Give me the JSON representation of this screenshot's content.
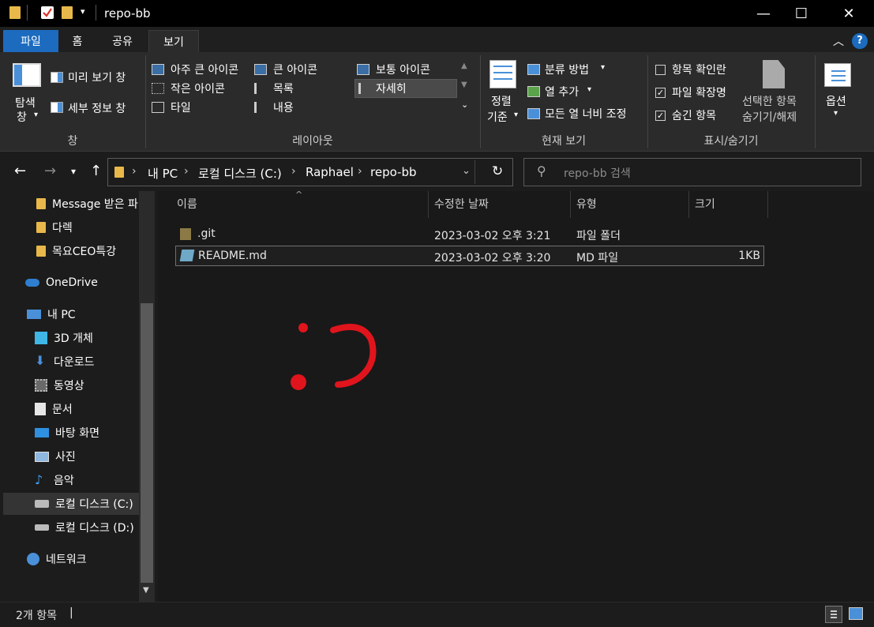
{
  "window": {
    "title": "repo-bb",
    "buttons": {
      "minimize": "—",
      "maximize": "☐",
      "close": "✕"
    }
  },
  "ribbon_tabs": [
    {
      "label": "파일"
    },
    {
      "label": "홈"
    },
    {
      "label": "공유"
    },
    {
      "label": "보기"
    }
  ],
  "ribbon": {
    "pane": {
      "nav_pane_label_1": "탐색",
      "nav_pane_label_2": "창",
      "preview_pane": "미리 보기 창",
      "details_pane": "세부 정보 창",
      "group_label": "창"
    },
    "layout": {
      "items": [
        "아주 큰 아이콘",
        "큰 아이콘",
        "보통 아이콘",
        "작은 아이콘",
        "목록",
        "자세히",
        "타일",
        "내용"
      ],
      "selected": "자세히",
      "group_label": "레이아웃"
    },
    "current_view": {
      "sort_by_1": "정렬",
      "sort_by_2": "기준",
      "group_by": "분류 방법",
      "add_columns": "열 추가",
      "size_all_columns": "모든 열 너비 조정",
      "group_label": "현재 보기"
    },
    "show_hide": {
      "item_checkboxes": "항목 확인란",
      "file_extensions": "파일 확장명",
      "hidden_items": "숨긴 항목",
      "hide_selected_1": "선택한 항목",
      "hide_selected_2": "숨기기/해제",
      "group_label": "표시/숨기기",
      "checked": [
        false,
        true,
        true
      ]
    },
    "options": {
      "label": "옵션"
    }
  },
  "address": {
    "crumbs": [
      "내 PC",
      "로컬 디스크 (C:)",
      "Raphael",
      "repo-bb"
    ],
    "search_placeholder": "repo-bb 검색"
  },
  "nav_pane": {
    "items": [
      {
        "label": "Message 받은 파",
        "icon": "folder-icon"
      },
      {
        "label": "다렉",
        "icon": "folder-icon"
      },
      {
        "label": "목요CEO특강",
        "icon": "folder-icon"
      },
      {
        "label": "OneDrive",
        "icon": "cloud-icon"
      },
      {
        "label": "내 PC",
        "icon": "pc-icon"
      },
      {
        "label": "3D 개체",
        "icon": "cube-icon"
      },
      {
        "label": "다운로드",
        "icon": "download-icon"
      },
      {
        "label": "동영상",
        "icon": "video-icon"
      },
      {
        "label": "문서",
        "icon": "document-icon"
      },
      {
        "label": "바탕 화면",
        "icon": "desktop-icon"
      },
      {
        "label": "사진",
        "icon": "pictures-icon"
      },
      {
        "label": "음악",
        "icon": "music-icon"
      },
      {
        "label": "로컬 디스크 (C:)",
        "icon": "drive-icon"
      },
      {
        "label": "로컬 디스크 (D:)",
        "icon": "drive-icon"
      },
      {
        "label": "네트워크",
        "icon": "network-icon"
      }
    ],
    "selected": "로컬 디스크 (C:)"
  },
  "file_list": {
    "columns": [
      "이름",
      "수정한 날짜",
      "유형",
      "크기"
    ],
    "rows": [
      {
        "name": ".git",
        "modified": "2023-03-02 오후 3:21",
        "type": "파일 폴더",
        "size": "",
        "icon": "folder-icon"
      },
      {
        "name": "README.md",
        "modified": "2023-03-02 오후 3:20",
        "type": "MD 파일",
        "size": "1KB",
        "icon": "markdown-file-icon"
      }
    ],
    "selected_row": 1
  },
  "status": {
    "item_count": "2개 항목"
  },
  "colors": {
    "accent": "#1c6bbf",
    "folder": "#e8b84a",
    "drawing": "#e0141c",
    "background": "#191919"
  }
}
